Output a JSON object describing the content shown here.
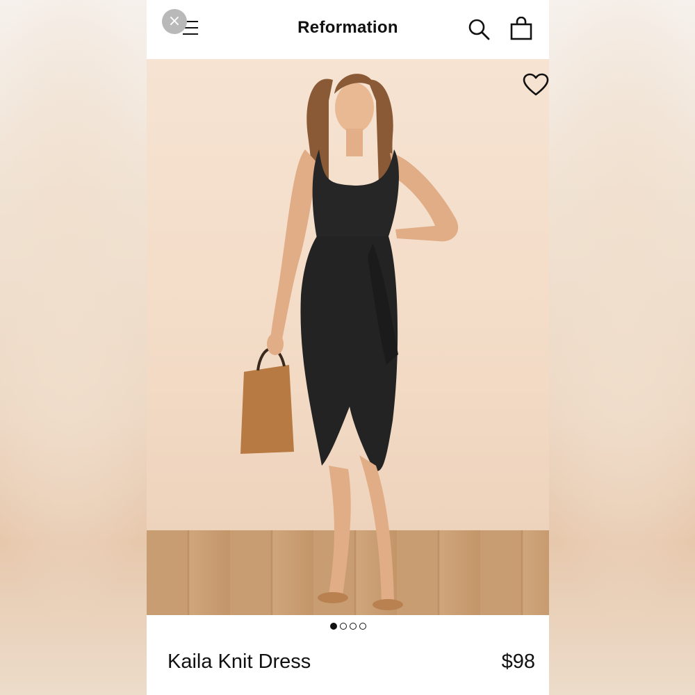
{
  "header": {
    "close_symbol": "×",
    "brand": "Reformation",
    "icons": {
      "close": "close-icon",
      "menu": "menu-icon",
      "search": "search-icon",
      "bag": "shopping-bag-icon"
    }
  },
  "product": {
    "image": {
      "description_icon": "product-photo",
      "wishlist_icon": "heart-icon"
    },
    "carousel": {
      "total": 4,
      "active_index": 0
    },
    "name": "Kaila Knit Dress",
    "price": "$98"
  },
  "colors": {
    "brand_text": "#111111",
    "close_button_bg": "#b9b9b9",
    "dress": "#232323",
    "background": "#f3dcc7"
  }
}
